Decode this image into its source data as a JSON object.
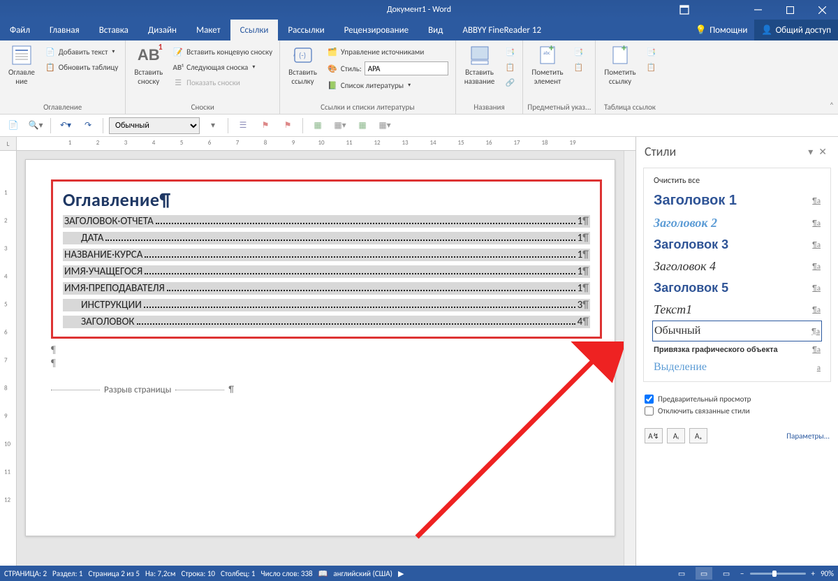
{
  "title": "Документ1 - Word",
  "tabs": [
    "Файл",
    "Главная",
    "Вставка",
    "Дизайн",
    "Макет",
    "Ссылки",
    "Рассылки",
    "Рецензирование",
    "Вид",
    "ABBYY FineReader 12"
  ],
  "active_tab_index": 5,
  "assistant": "Помощни",
  "share": "Общий доступ",
  "ribbon": {
    "toc": {
      "group": "Оглавление",
      "btn": "Оглавле\nние",
      "add_text": "Добавить текст",
      "update": "Обновить таблицу"
    },
    "footnotes": {
      "group": "Сноски",
      "insert": "Вставить\nсноску",
      "ab": "AB",
      "endnote": "Вставить концевую сноску",
      "next": "Следующая сноска",
      "show": "Показать сноски"
    },
    "citations": {
      "group": "Ссылки и списки литературы",
      "insert": "Вставить\nссылку",
      "manage": "Управление источниками",
      "style_label": "Стиль:",
      "style_value": "APA",
      "biblio": "Список литературы"
    },
    "captions": {
      "group": "Названия",
      "insert": "Вставить\nназвание"
    },
    "index": {
      "group": "Предметный указ...",
      "mark": "Пометить\nэлемент"
    },
    "authorities": {
      "group": "Таблица ссылок",
      "mark": "Пометить\nссылку"
    }
  },
  "qat_style": "Обычный",
  "doc": {
    "toc_title": "Оглавление",
    "rows": [
      {
        "label": "ЗАГОЛОВОК·ОТЧЕТА",
        "page": "1",
        "level": 1
      },
      {
        "label": "ДАТА",
        "page": "1",
        "level": 2
      },
      {
        "label": "НАЗВАНИЕ·КУРСА",
        "page": "1",
        "level": 1
      },
      {
        "label": "ИМЯ·УЧАЩЕГОСЯ",
        "page": "1",
        "level": 1
      },
      {
        "label": "ИМЯ·ПРЕПОДАВАТЕЛЯ",
        "page": "1",
        "level": 1
      },
      {
        "label": "ИНСТРУКЦИИ",
        "page": "3",
        "level": 2
      },
      {
        "label": "ЗАГОЛОВОК",
        "page": "4",
        "level": 2
      }
    ],
    "page_break": "Разрыв страницы"
  },
  "styles_pane": {
    "title": "Стили",
    "clear": "Очистить все",
    "items": [
      {
        "name": "Заголовок 1",
        "css": "font:900 20px Arial;color:#2f5496"
      },
      {
        "name": "Заголовок 2",
        "css": "font:italic 700 18px Georgia;color:#5b9bd5"
      },
      {
        "name": "Заголовок 3",
        "css": "font:900 18px Arial;color:#2f5496"
      },
      {
        "name": "Заголовок 4",
        "css": "font:italic 18px Georgia;color:#333"
      },
      {
        "name": "Заголовок 5",
        "css": "font:900 18px Arial;color:#2f5496"
      },
      {
        "name": "Текст1",
        "css": "font:italic 18px Georgia;color:#333"
      },
      {
        "name": "Обычный",
        "css": "font:16px Georgia;color:#333",
        "selected": true
      },
      {
        "name": "Привязка графического объекта",
        "css": "font:700 11px Arial;color:#333"
      },
      {
        "name": "Выделение",
        "css": "font:16px Georgia;color:#5b9bd5",
        "mark": "a"
      }
    ],
    "preview": "Предварительный просмотр",
    "disable_linked": "Отключить связанные стили",
    "options": "Параметры..."
  },
  "status": {
    "page": "СТРАНИЦА: 2",
    "section": "Раздел: 1",
    "pageof": "Страница 2 из 5",
    "pos": "На: 7,2см",
    "line": "Строка: 10",
    "col": "Столбец: 1",
    "words": "Число слов: 338",
    "lang": "английский (США)",
    "zoom": "90%"
  },
  "ruler": {
    "hmarks": [
      1,
      2,
      3,
      4,
      5,
      6,
      7,
      8,
      9,
      10,
      11,
      12,
      13,
      14,
      15,
      16,
      17,
      18,
      19
    ],
    "corner": "L"
  }
}
